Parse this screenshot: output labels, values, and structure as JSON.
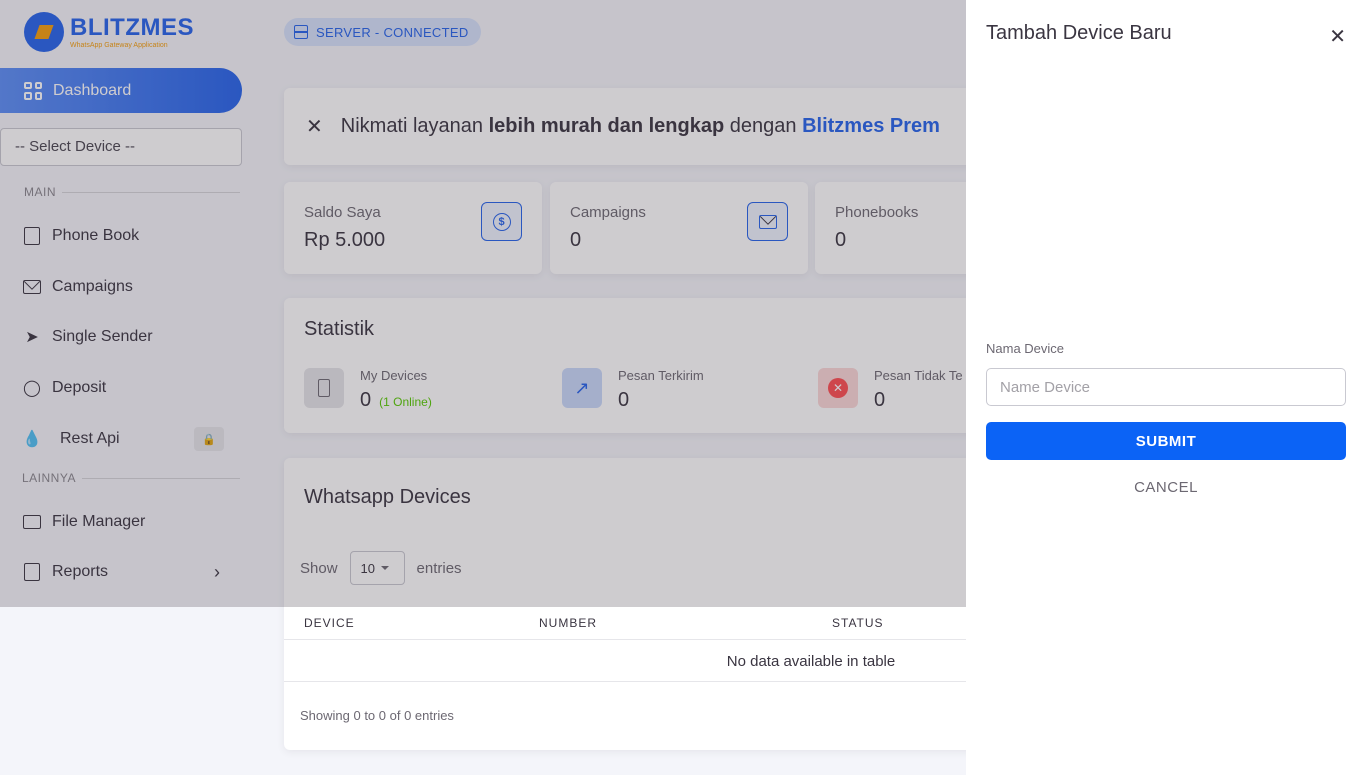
{
  "logo": {
    "name": "BLITZMES",
    "subtitle": "WhatsApp Gateway Application"
  },
  "sidebar": {
    "dashboard_label": "Dashboard",
    "select_device": "-- Select Device --",
    "section_main": "MAIN",
    "section_other": "LAINNYA",
    "items": [
      {
        "label": "Phone Book",
        "icon": "phonebook-icon"
      },
      {
        "label": "Campaigns",
        "icon": "mail-icon"
      },
      {
        "label": "Single Sender",
        "icon": "send-icon"
      },
      {
        "label": "Deposit",
        "icon": "coins-icon"
      },
      {
        "label": "Rest Api",
        "icon": "fire-icon",
        "locked": true
      },
      {
        "label": "File Manager",
        "icon": "folder-icon"
      },
      {
        "label": "Reports",
        "icon": "clipboard-icon"
      }
    ]
  },
  "header": {
    "server_status": "SERVER - CONNECTED"
  },
  "promo": {
    "text1": "Nikmati layanan ",
    "bold": "lebih murah dan lengkap",
    "text2": " dengan ",
    "brand": "Blitzmes Prem"
  },
  "stats": [
    {
      "label": "Saldo Saya",
      "value": "Rp 5.000",
      "icon": "dollar-icon"
    },
    {
      "label": "Campaigns",
      "value": "0",
      "icon": "mail-icon"
    },
    {
      "label": "Phonebooks",
      "value": "0",
      "icon": "book-icon"
    }
  ],
  "statistik": {
    "title": "Statistik",
    "items": [
      {
        "label": "My Devices",
        "value": "0",
        "extra": "(1 Online)"
      },
      {
        "label": "Pesan Terkirim",
        "value": "0"
      },
      {
        "label": "Pesan Tidak Te",
        "value": "0"
      }
    ]
  },
  "devices": {
    "title": "Whatsapp Devices",
    "show": "Show",
    "entries_value": "10",
    "entries": "entries",
    "columns": [
      "DEVICE",
      "NUMBER",
      "STATUS"
    ],
    "empty": "No data available in table",
    "showing": "Showing 0 to 0 of 0 entries"
  },
  "drawer": {
    "title": "Tambah Device Baru",
    "field_label": "Nama Device",
    "placeholder": "Name Device",
    "submit": "SUBMIT",
    "cancel": "CANCEL"
  },
  "colors": {
    "accent": "#2563eb",
    "submit": "#0b63f6",
    "online": "#56ca00",
    "logo_accent": "#f59e0b"
  }
}
